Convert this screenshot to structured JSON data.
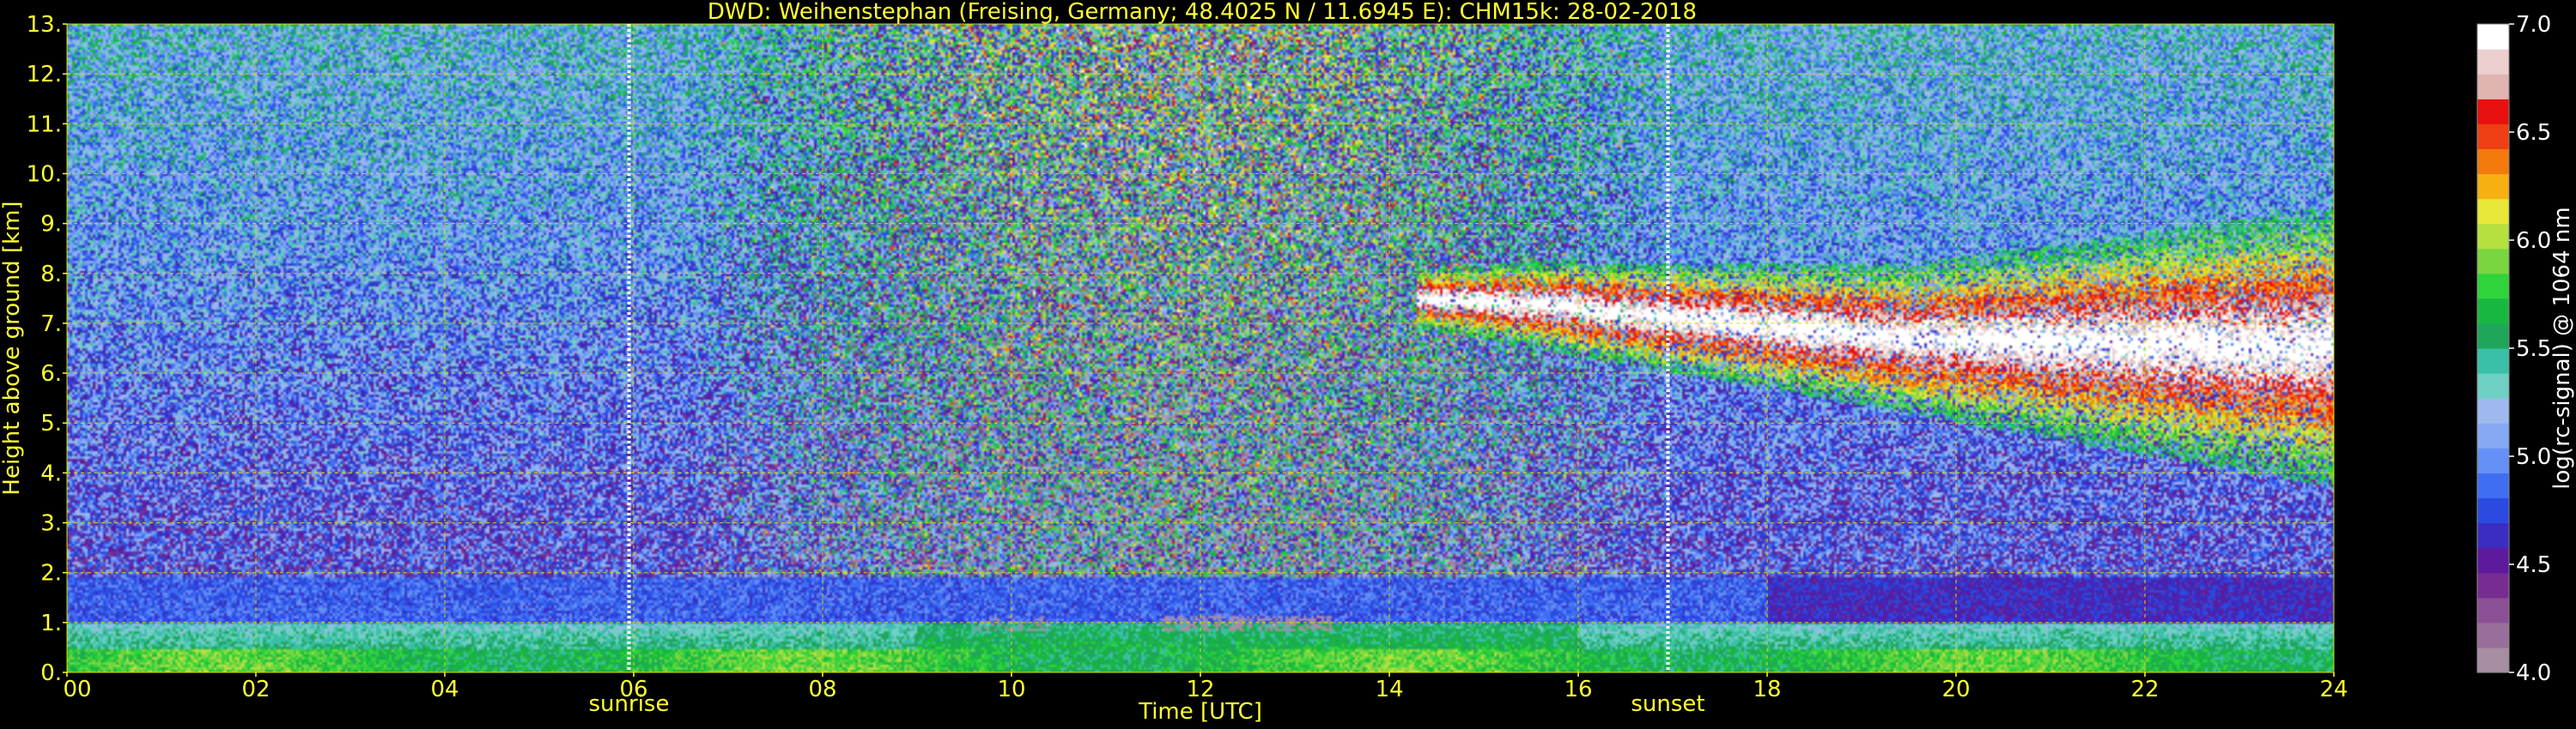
{
  "chart_data": {
    "type": "heatmap",
    "title": "DWD: Weihenstephan (Freising, Germany; 48.4025 N / 11.6945 E):    CHM15k: 28-02-2018",
    "xlabel": "Time [UTC]",
    "ylabel": "Height above ground [km]",
    "colorbar_label": "log(rc-signal) @ 1064 nm",
    "xlim": [
      0,
      24
    ],
    "ylim": [
      0,
      13
    ],
    "x_ticks": [
      0,
      2,
      4,
      6,
      8,
      10,
      12,
      14,
      16,
      18,
      20,
      22,
      24
    ],
    "x_tick_labels": [
      "00",
      "02",
      "04",
      "06",
      "08",
      "10",
      "12",
      "14",
      "16",
      "18",
      "20",
      "22",
      "24"
    ],
    "y_ticks": [
      0,
      1,
      2,
      3,
      4,
      5,
      6,
      7,
      8,
      9,
      10,
      11,
      12,
      13
    ],
    "y_tick_labels": [
      "0.",
      "1.",
      "2.",
      "3.",
      "4.",
      "5.",
      "6.",
      "7.",
      "8.",
      "9.",
      "10.",
      "11.",
      "12.",
      "13."
    ],
    "colorbar_range": [
      4.0,
      7.0
    ],
    "colorbar_ticks": [
      4.0,
      4.5,
      5.0,
      5.5,
      6.0,
      6.5,
      7.0
    ],
    "colorbar_tick_labels": [
      "4.0",
      "4.5",
      "5.0",
      "5.5",
      "6.0",
      "6.5",
      "7.0"
    ],
    "events": [
      {
        "label": "sunrise",
        "time": 5.95
      },
      {
        "label": "sunset",
        "time": 16.95
      }
    ],
    "grid": true,
    "colors": {
      "text": "#ffff33",
      "grid": "#dddd00",
      "colorbar_text": "#ffffff",
      "background": "#000000"
    },
    "colormap": [
      "#a78ea1",
      "#9a6e9a",
      "#8a4f94",
      "#772c92",
      "#5d1a9c",
      "#3a2cc0",
      "#2a4ae0",
      "#3f6ef2",
      "#6590f5",
      "#86a9f4",
      "#9db9ee",
      "#6fd0c4",
      "#3ac0a8",
      "#1ea65a",
      "#18b840",
      "#2ed43a",
      "#7ad640",
      "#b6e040",
      "#e8e838",
      "#f7b012",
      "#f37a0d",
      "#ef3f14",
      "#e81010",
      "#e0b4b0",
      "#ecd0cf",
      "#ffffff"
    ],
    "layers": {
      "boundary_layer_top_km": 1.0,
      "residual_layer_top_km": 1.9,
      "cloud_layer": "cirrus descending from ~8.3 km at 16 UTC to ~3.8 km at 24 UTC",
      "low_cloud_hits": "10-13 UTC near 1 km"
    }
  }
}
